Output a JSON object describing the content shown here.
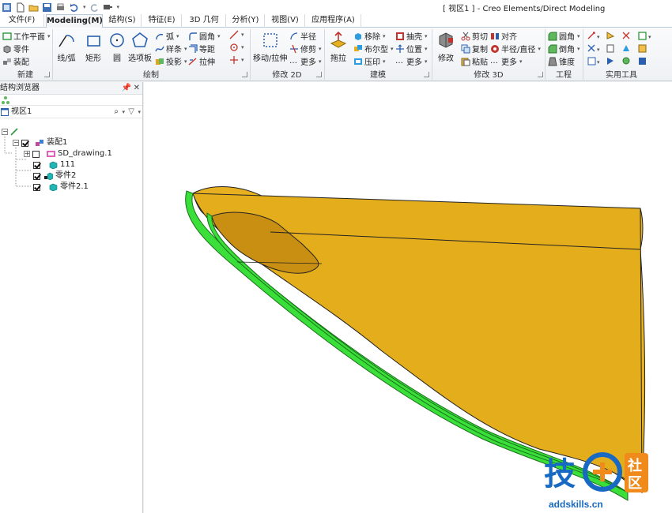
{
  "window_title": "[ 视区1 ] - Creo Elements/Direct Modeling",
  "tabs": [
    "文件(F)",
    "Modeling(M)",
    "结构(S)",
    "特征(E)",
    "3D 几何",
    "分析(Y)",
    "视图(V)",
    "应用程序(A)"
  ],
  "ribbon": {
    "new_group": {
      "label": "新建",
      "items": [
        "工作平面",
        "零件",
        "装配"
      ]
    },
    "draw_group": {
      "label": "绘制",
      "big": [
        "线/弧",
        "矩形",
        "圆",
        "选项板"
      ],
      "small": [
        "弧",
        "样条",
        "投影",
        "圆角",
        "等距",
        "拉伸"
      ]
    },
    "modify2d_group": {
      "label": "修改 2D",
      "big": [
        "移动/拉伸"
      ],
      "small": [
        "半径",
        "修剪",
        "更多"
      ]
    },
    "model_group": {
      "label": "建模",
      "big": [
        "拖拉"
      ],
      "small": [
        "移除",
        "布尔型",
        "压印",
        "抽壳",
        "位置",
        "更多"
      ]
    },
    "modify3d_group": {
      "label": "修改 3D",
      "big": [
        "修改"
      ],
      "small": [
        "剪切",
        "复制",
        "粘贴",
        "对齐",
        "半径/直径",
        "更多"
      ]
    },
    "engineering_group": {
      "label": "工程",
      "small": [
        "圆角",
        "倒角",
        "锥度"
      ]
    },
    "utility_group": {
      "label": "实用工具"
    }
  },
  "structure_browser": {
    "title": "结构浏览器",
    "viewport_label": "视区1",
    "tree": [
      {
        "label": "装配1",
        "checked": true
      },
      {
        "label": "SD_drawing.1",
        "checked": false
      },
      {
        "label": "111",
        "checked": true
      },
      {
        "label": "零件2",
        "checked": true
      },
      {
        "label": "零件2.1",
        "checked": true
      }
    ]
  },
  "watermark": {
    "site": "addskills.cn",
    "chars": [
      "技",
      "社",
      "区"
    ]
  },
  "colors": {
    "part_body": "#e6b020",
    "part_edge": "#3adf3a",
    "ribbon_accent": "#2b579a"
  }
}
